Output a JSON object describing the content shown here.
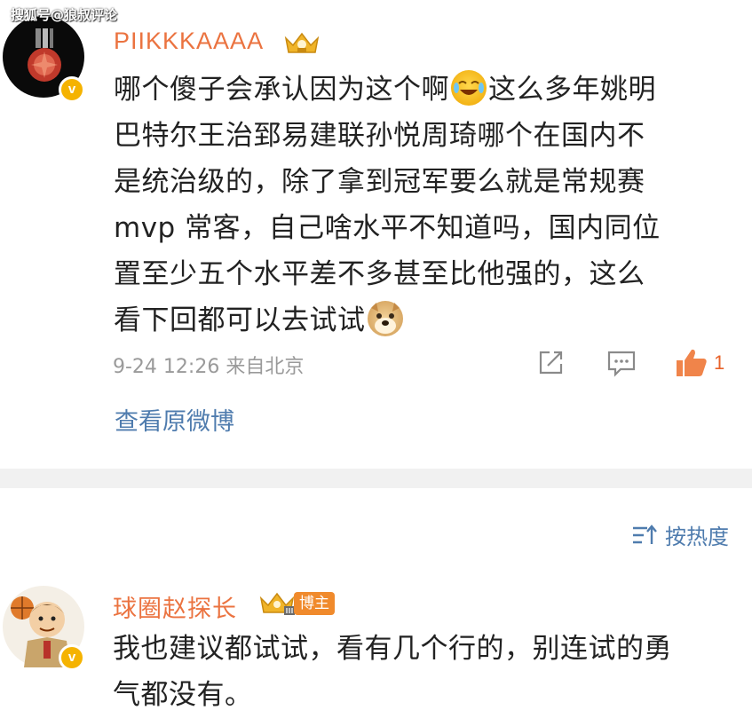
{
  "watermark": "搜狐号@狼叔评论",
  "comment1": {
    "username": "PIIKKKAAAA",
    "lines": [
      "哪个傻子会承认因为这个啊",
      "这么多年姚明",
      "巴特尔王治郅易建联孙悦周琦哪个在国内不",
      "是统治级的，除了拿到冠军要么就是常规赛",
      "mvp 常客，自己啥水平不知道吗，国内同位",
      "置至少五个水平差不多甚至比他强的，这么",
      "看下回都可以去试试"
    ],
    "timestamp": "9-24 12:26 来自北京",
    "like_count": "1",
    "view_original": "查看原微博",
    "verified_badge": "v",
    "icons": [
      "share-icon",
      "comment-icon",
      "like-icon",
      "laugh-cry-emoji",
      "doge-emoji",
      "crown-badge-icon"
    ]
  },
  "sort": {
    "label": "按热度",
    "icon": "sort-icon"
  },
  "comment2": {
    "username": "球圈赵探长",
    "host_tag": "博主",
    "verified_badge": "v",
    "lines": [
      "我也建议都试试，看有几个行的，别连试的勇",
      "气都没有。"
    ]
  },
  "colors": {
    "username": "#eb7340",
    "link": "#4f7cae",
    "meta": "#9a9a9a",
    "like": "#e8622a",
    "verified": "#f5b301",
    "divider": "#f1f1f1"
  }
}
